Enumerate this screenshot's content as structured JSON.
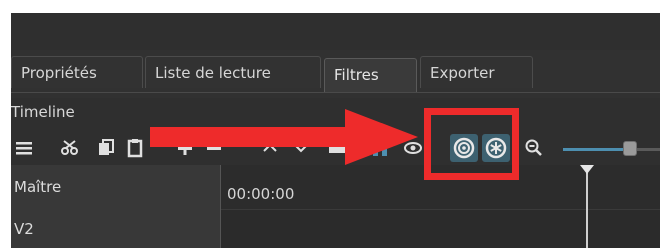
{
  "tabs": [
    {
      "label": "Propriétés",
      "active": false
    },
    {
      "label": "Liste de lecture",
      "active": false
    },
    {
      "label": "Filtres",
      "active": true
    },
    {
      "label": "Exporter",
      "active": false
    }
  ],
  "timeline": {
    "title": "Timeline",
    "tracks": [
      "Maître",
      "V2"
    ],
    "timecode": "00:00:00"
  },
  "toolbar_icons": [
    "menu-icon",
    "cut-icon",
    "copy-icon",
    "paste-icon",
    "append-icon",
    "remove-icon",
    "lift-icon",
    "overwrite-icon",
    "split-icon",
    "snap-icon",
    "scrub-icon",
    "ripple-icon",
    "ripple-all-icon",
    "zoom-out-icon",
    "zoom-slider"
  ],
  "colors": {
    "background": "#2f2f2f",
    "annotation": "#ee2b2b",
    "active_button": "#3d6170",
    "zoom_accent": "#4d8fb0"
  }
}
